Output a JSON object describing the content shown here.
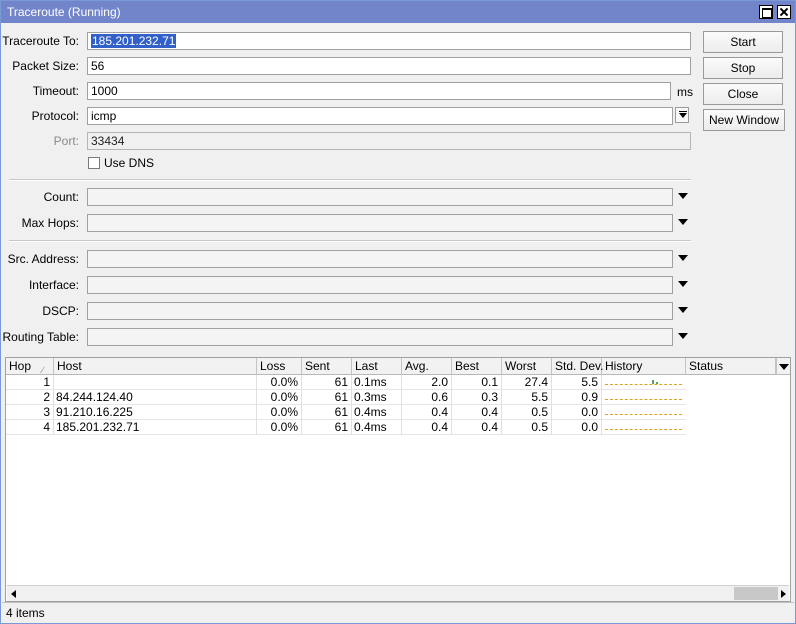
{
  "window": {
    "title": "Traceroute (Running)",
    "maximize_icon": "maximize-icon",
    "close_icon": "close-icon",
    "titlebar_color": "#7285cb"
  },
  "form": {
    "traceroute_to": {
      "label": "Traceroute To:",
      "value": "185.201.232.71"
    },
    "packet_size": {
      "label": "Packet Size:",
      "value": "56"
    },
    "timeout": {
      "label": "Timeout:",
      "value": "1000",
      "unit": "ms"
    },
    "protocol": {
      "label": "Protocol:",
      "value": "icmp"
    },
    "port": {
      "label": "Port:",
      "value": "33434"
    },
    "use_dns": {
      "label": "Use DNS",
      "checked": false
    },
    "count": {
      "label": "Count:",
      "value": ""
    },
    "max_hops": {
      "label": "Max Hops:",
      "value": ""
    },
    "src_address": {
      "label": "Src. Address:",
      "value": ""
    },
    "interface": {
      "label": "Interface:",
      "value": ""
    },
    "dscp": {
      "label": "DSCP:",
      "value": ""
    },
    "routing_table": {
      "label": "Routing Table:",
      "value": ""
    }
  },
  "buttons": {
    "start": "Start",
    "stop": "Stop",
    "close": "Close",
    "new_window": "New Window"
  },
  "table": {
    "columns": [
      "Hop",
      "Host",
      "Loss",
      "Sent",
      "Last",
      "Avg.",
      "Best",
      "Worst",
      "Std. Dev.",
      "History",
      "Status"
    ],
    "rows": [
      {
        "hop": "1",
        "host": "",
        "loss": "0.0%",
        "sent": "61",
        "last": "0.1ms",
        "avg": "2.0",
        "best": "0.1",
        "worst": "27.4",
        "stddev": "5.5",
        "status": ""
      },
      {
        "hop": "2",
        "host": "84.244.124.40",
        "loss": "0.0%",
        "sent": "61",
        "last": "0.3ms",
        "avg": "0.6",
        "best": "0.3",
        "worst": "5.5",
        "stddev": "0.9",
        "status": ""
      },
      {
        "hop": "3",
        "host": "91.210.16.225",
        "loss": "0.0%",
        "sent": "61",
        "last": "0.4ms",
        "avg": "0.4",
        "best": "0.4",
        "worst": "0.5",
        "stddev": "0.0",
        "status": ""
      },
      {
        "hop": "4",
        "host": "185.201.232.71",
        "loss": "0.0%",
        "sent": "61",
        "last": "0.4ms",
        "avg": "0.4",
        "best": "0.4",
        "worst": "0.5",
        "stddev": "0.0",
        "status": ""
      }
    ],
    "history_bar_color": "#5ca45c",
    "history_baseline_color": "#d8a320"
  },
  "status_bar": {
    "text": "4 items"
  }
}
